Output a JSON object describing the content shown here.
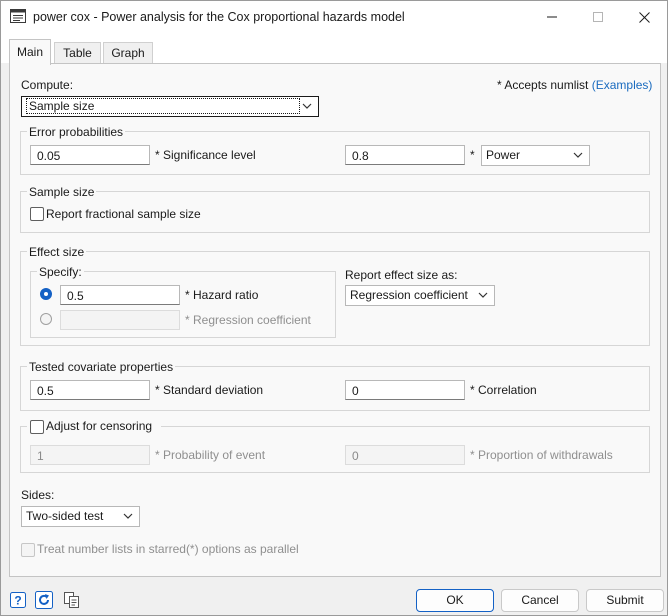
{
  "window": {
    "title": "power cox - Power analysis for the Cox proportional hazards model",
    "icon": "dialog-icon"
  },
  "tabs": [
    {
      "label": "Main",
      "active": true
    },
    {
      "label": "Table",
      "active": false
    },
    {
      "label": "Graph",
      "active": false
    }
  ],
  "compute": {
    "label": "Compute:",
    "selected": "Sample size",
    "numlist_note": "* Accepts numlist",
    "examples_link": "(Examples)"
  },
  "error_prob": {
    "title": "Error probabilities",
    "alpha_value": "0.05",
    "alpha_label": "* Significance level",
    "power_value": "0.8",
    "power_star": "*",
    "power_select": "Power"
  },
  "sample_size": {
    "title": "Sample size",
    "fractional_label": "Report fractional sample size",
    "fractional_checked": false
  },
  "effect_size": {
    "title": "Effect size",
    "specify_label": "Specify:",
    "hazard_value": "0.5",
    "hazard_label": "* Hazard ratio",
    "hazard_selected": true,
    "regcoef_value": "",
    "regcoef_label": "* Regression coefficient",
    "report_label": "Report effect size as:",
    "report_selected": "Regression coefficient"
  },
  "covariate": {
    "title": "Tested covariate properties",
    "sd_value": "0.5",
    "sd_label": "* Standard deviation",
    "corr_value": "0",
    "corr_label": "* Correlation"
  },
  "censoring": {
    "title": "Adjust for censoring",
    "checked": false,
    "prob_value": "1",
    "prob_label": "* Probability of event",
    "withdraw_value": "0",
    "withdraw_label": "* Proportion of withdrawals"
  },
  "sides": {
    "label": "Sides:",
    "selected": "Two-sided test"
  },
  "parallel": {
    "label": "Treat number lists in starred(*) options as parallel",
    "checked": false
  },
  "footer": {
    "ok": "OK",
    "cancel": "Cancel",
    "submit": "Submit"
  },
  "colors": {
    "accent": "#1461c5",
    "link": "#1a6bbf",
    "panel": "#f9f9f9",
    "window_bg": "#f0f0f0"
  }
}
